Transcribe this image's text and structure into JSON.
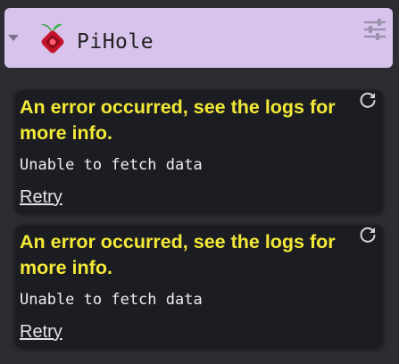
{
  "header": {
    "title": "PiHole",
    "logo_icon": "pihole-logo-icon",
    "settings_icon": "sliders-icon",
    "collapse_icon": "caret-down-icon"
  },
  "cards": [
    {
      "error_title": "An error occurred, see the logs for more info.",
      "error_detail": "Unable to fetch data",
      "retry_label": "Retry",
      "refresh_icon": "refresh-icon"
    },
    {
      "error_title": "An error occurred, see the logs for more info.",
      "error_detail": "Unable to fetch data",
      "retry_label": "Retry",
      "refresh_icon": "refresh-icon"
    }
  ],
  "colors": {
    "background": "#2b2d33",
    "header_bg": "#d8c3ec",
    "card_bg": "#1c1d22",
    "error_title": "#f2e937",
    "text": "#eeeeee"
  }
}
